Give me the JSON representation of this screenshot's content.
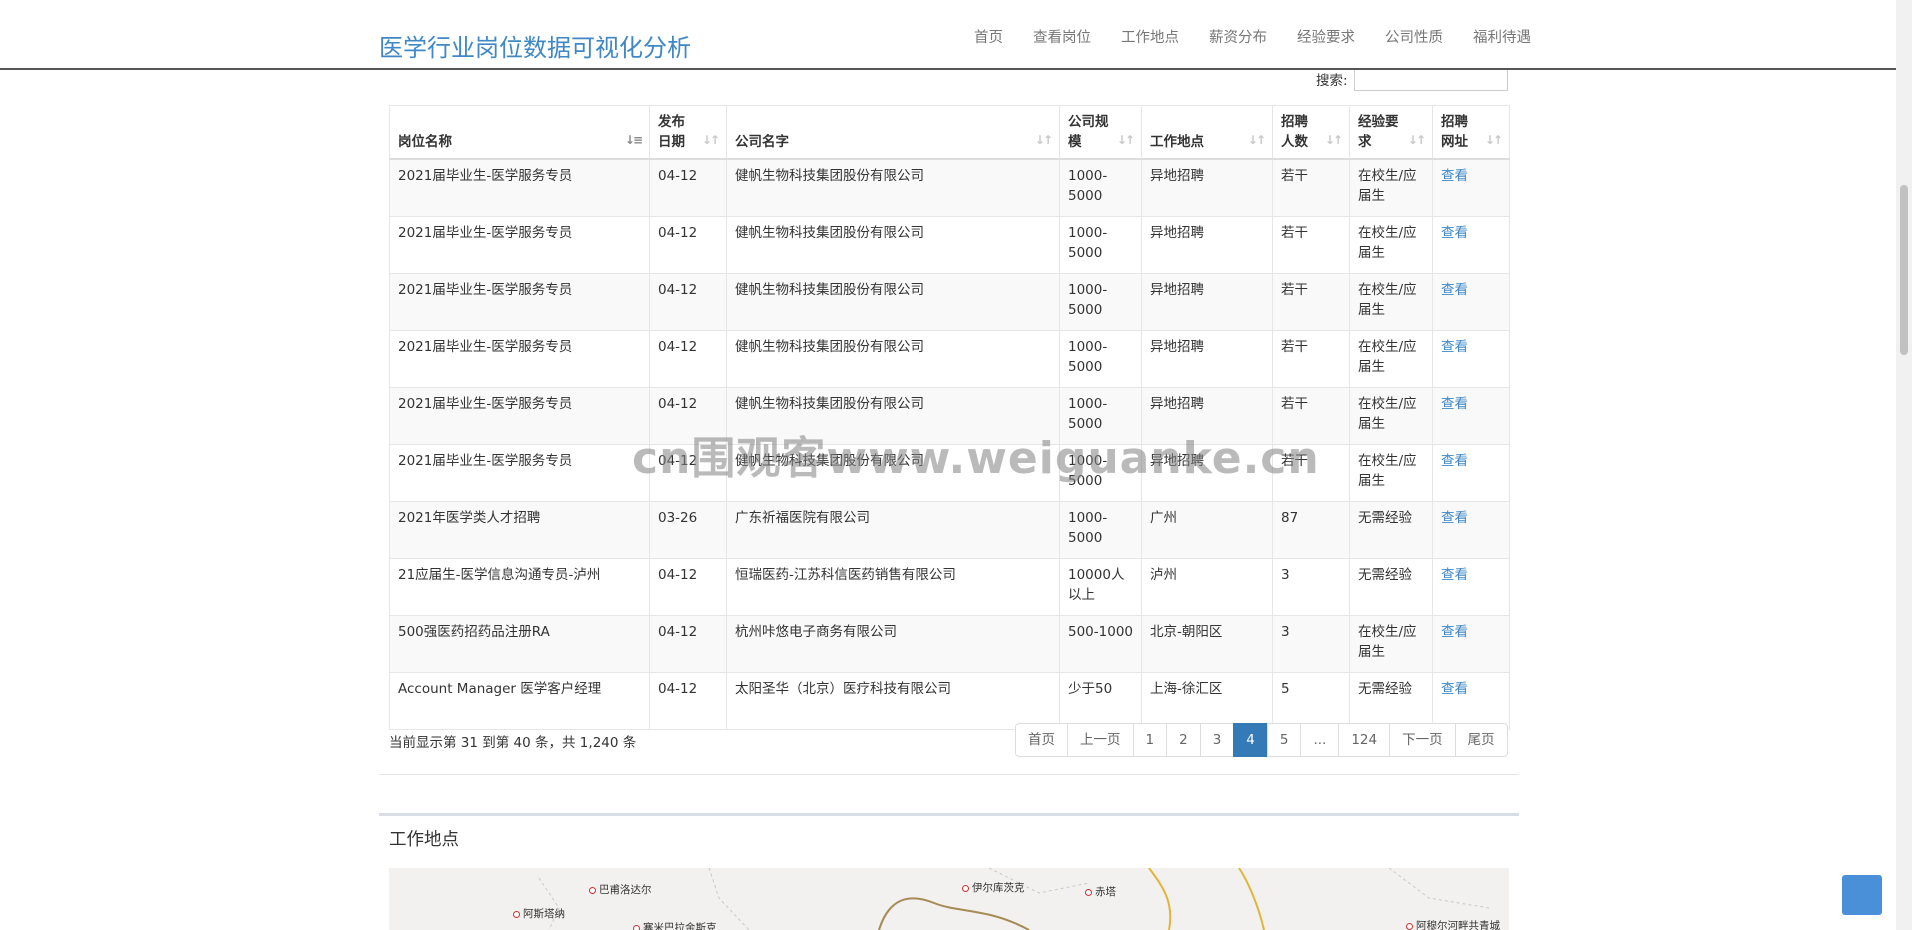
{
  "header": {
    "title": "医学行业岗位数据可视化分析",
    "nav": [
      "首页",
      "查看岗位",
      "工作地点",
      "薪资分布",
      "经验要求",
      "公司性质",
      "福利待遇"
    ]
  },
  "search": {
    "label": "搜索:",
    "value": ""
  },
  "table": {
    "columns": [
      "岗位名称",
      "发布日期",
      "公司名字",
      "公司规模",
      "工作地点",
      "招聘人数",
      "经验要求",
      "招聘网址"
    ],
    "rows": [
      [
        "2021届毕业生-医学服务专员",
        "04-12",
        "健帆生物科技集团股份有限公司",
        "1000-5000",
        "异地招聘",
        "若干",
        "在校生/应届生",
        "查看"
      ],
      [
        "2021届毕业生-医学服务专员",
        "04-12",
        "健帆生物科技集团股份有限公司",
        "1000-5000",
        "异地招聘",
        "若干",
        "在校生/应届生",
        "查看"
      ],
      [
        "2021届毕业生-医学服务专员",
        "04-12",
        "健帆生物科技集团股份有限公司",
        "1000-5000",
        "异地招聘",
        "若干",
        "在校生/应届生",
        "查看"
      ],
      [
        "2021届毕业生-医学服务专员",
        "04-12",
        "健帆生物科技集团股份有限公司",
        "1000-5000",
        "异地招聘",
        "若干",
        "在校生/应届生",
        "查看"
      ],
      [
        "2021届毕业生-医学服务专员",
        "04-12",
        "健帆生物科技集团股份有限公司",
        "1000-5000",
        "异地招聘",
        "若干",
        "在校生/应届生",
        "查看"
      ],
      [
        "2021届毕业生-医学服务专员",
        "04-12",
        "健帆生物科技集团股份有限公司",
        "1000-5000",
        "异地招聘",
        "若干",
        "在校生/应届生",
        "查看"
      ],
      [
        "2021年医学类人才招聘",
        "03-26",
        "广东祈福医院有限公司",
        "1000-5000",
        "广州",
        "87",
        "无需经验",
        "查看"
      ],
      [
        "21应届生-医学信息沟通专员-泸州",
        "04-12",
        "恒瑞医药-江苏科信医药销售有限公司",
        "10000人以上",
        "泸州",
        "3",
        "无需经验",
        "查看"
      ],
      [
        "500强医药招药品注册RA",
        "04-12",
        "杭州咔悠电子商务有限公司",
        "500-1000",
        "北京-朝阳区",
        "3",
        "在校生/应届生",
        "查看"
      ],
      [
        "Account Manager 医学客户经理",
        "04-12",
        "太阳圣华（北京）医疗科技有限公司",
        "少于50",
        "上海-徐汇区",
        "5",
        "无需经验",
        "查看"
      ]
    ]
  },
  "pagination": {
    "info": "当前显示第 31 到第 40 条，共 1,240 条",
    "pages": [
      "首页",
      "上一页",
      "1",
      "2",
      "3",
      "4",
      "5",
      "...",
      "124",
      "下一页",
      "尾页"
    ],
    "active": "4"
  },
  "section": {
    "title": "工作地点"
  },
  "map": {
    "labels": [
      "巴甫洛达尔",
      "阿斯塔纳",
      "塞米巴拉金斯克",
      "伊尔库茨克",
      "赤塔",
      "阿穆尔河畔共青城"
    ]
  },
  "watermark": "cn围观客www.weiguanke.cn",
  "colors": {
    "brand": "#3f88c5",
    "accent": "#337ab7",
    "link": "#3f88c5"
  }
}
